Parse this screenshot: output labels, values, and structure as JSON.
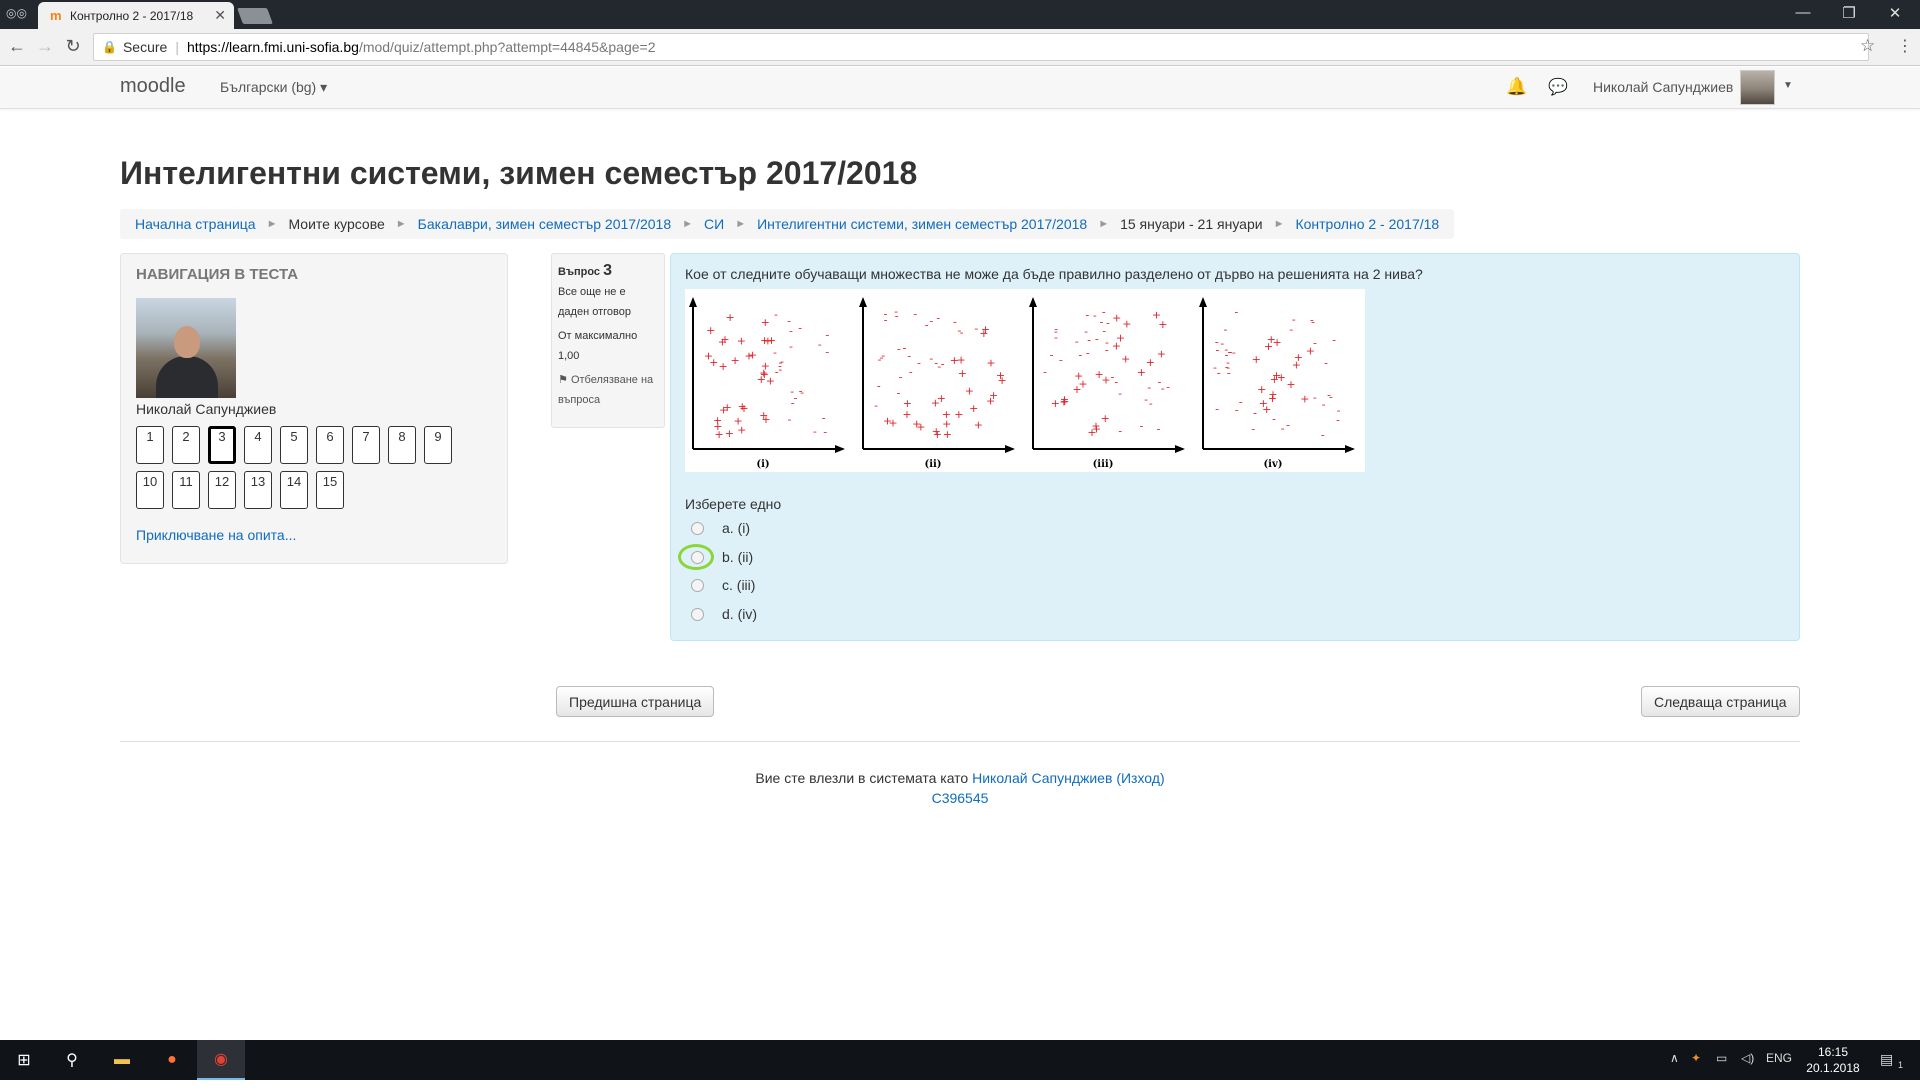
{
  "browser": {
    "tab_title": "Контролно 2 - 2017/18",
    "tab_favicon": "m",
    "secure_label": "Secure",
    "url_host": "https://learn.fmi.uni-sofia.bg",
    "url_path": "/mod/quiz/attempt.php?attempt=44845&page=2"
  },
  "navbar": {
    "brand": "moodle",
    "language": "Български (bg) ▾",
    "user_name": "Николай Сапунджиев"
  },
  "page": {
    "title": "Интелигентни системи, зимен семестър 2017/2018",
    "breadcrumb": [
      {
        "label": "Начална страница",
        "link": true
      },
      {
        "label": "Моите курсове",
        "link": false
      },
      {
        "label": "Бакалаври, зимен семестър 2017/2018",
        "link": true
      },
      {
        "label": "СИ",
        "link": true
      },
      {
        "label": "Интелигентни системи, зимен семестър 2017/2018",
        "link": true
      },
      {
        "label": "15 януари - 21 януари",
        "link": false
      },
      {
        "label": "Контролно 2 - 2017/18",
        "link": true
      }
    ]
  },
  "quiz_nav": {
    "title": "НАВИГАЦИЯ В ТЕСТА",
    "user_name": "Николай Сапунджиев",
    "questions": [
      "1",
      "2",
      "3",
      "4",
      "5",
      "6",
      "7",
      "8",
      "9",
      "10",
      "11",
      "12",
      "13",
      "14",
      "15"
    ],
    "current_question": 3,
    "finish_link": "Приключване на опита..."
  },
  "question_info": {
    "label": "Въпрос",
    "number": "3",
    "state": "Все още не е даден отговор",
    "marks": "От максимално 1,00",
    "flag_label": "Отбелязване на въпроса"
  },
  "question": {
    "text": "Кое от следните обучаващи множества не може да бъде правилно разделено от дърво на решенията на 2 нива?",
    "figure_labels": [
      "(i)",
      "(ii)",
      "(iii)",
      "(iv)"
    ],
    "prompt": "Изберете едно",
    "answers": [
      "a. (i)",
      "b. (ii)",
      "c. (iii)",
      "d. (iv)"
    ],
    "plus_color": "#e0222a",
    "minus_color": "#e0222a"
  },
  "buttons": {
    "previous": "Предишна страница",
    "next": "Следваща страница"
  },
  "footer": {
    "logged_in_text": "Вие сте влезли в системата като",
    "user_link": "Николай Сапунджиев",
    "logout": "(Изход)",
    "id": "С396545"
  },
  "taskbar": {
    "lang": "ENG",
    "time": "16:15",
    "date": "20.1.2018 г.",
    "notifications": "1"
  }
}
